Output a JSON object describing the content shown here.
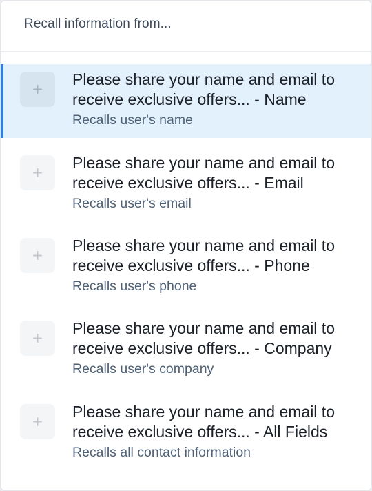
{
  "header": {
    "title": "Recall information from..."
  },
  "items": [
    {
      "title": "Please share your name and email to receive exclusive offers... - Name",
      "description": "Recalls user's name",
      "active": true
    },
    {
      "title": "Please share your name and email to receive exclusive offers... - Email",
      "description": "Recalls user's email",
      "active": false
    },
    {
      "title": "Please share your name and email to receive exclusive offers... - Phone",
      "description": "Recalls user's phone",
      "active": false
    },
    {
      "title": "Please share your name and email to receive exclusive offers... - Company",
      "description": "Recalls user's company",
      "active": false
    },
    {
      "title": "Please share your name and email to receive exclusive offers... - All Fields",
      "description": "Recalls all contact information",
      "active": false
    }
  ],
  "icons": {
    "item_icon": "plus-icon"
  },
  "colors": {
    "accent": "#2f7fe0",
    "active_background": "#e3f1fc",
    "description_text": "#4f6176"
  }
}
